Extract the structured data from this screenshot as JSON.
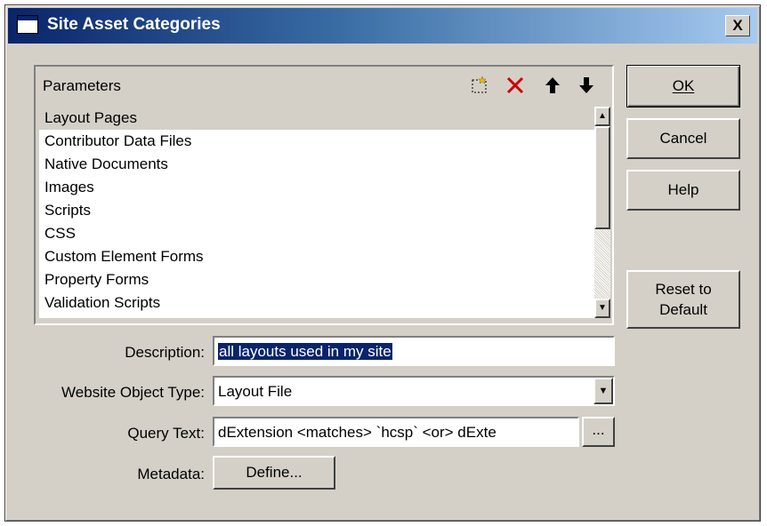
{
  "window": {
    "title": "Site Asset Categories",
    "close_label": "X"
  },
  "parameters": {
    "header": "Parameters",
    "toolbar": [
      {
        "icon": "new-item-icon",
        "glyph": "⬚"
      },
      {
        "icon": "delete-icon",
        "glyph": "✕",
        "color": "#cc0000"
      },
      {
        "icon": "move-up-icon",
        "glyph": "🡑"
      },
      {
        "icon": "move-down-icon",
        "glyph": "🡓"
      }
    ],
    "items": [
      "Layout Pages",
      "Contributor Data Files",
      "Native Documents",
      "Images",
      "Scripts",
      "CSS",
      "Custom Element Forms",
      "Property Forms",
      "Validation Scripts"
    ],
    "selected_index": 0
  },
  "buttons": {
    "ok": "OK",
    "cancel": "Cancel",
    "help": "Help",
    "reset_line1": "Reset to",
    "reset_line2": "Default"
  },
  "form": {
    "description_label": "Description:",
    "description_value": "all layouts used in my site",
    "object_type_label": "Website Object Type:",
    "object_type_value": "Layout File",
    "query_label": "Query Text:",
    "query_value": "dExtension <matches> `hcsp` <or> dExte",
    "query_browse": "...",
    "metadata_label": "Metadata:",
    "metadata_button": "Define..."
  }
}
